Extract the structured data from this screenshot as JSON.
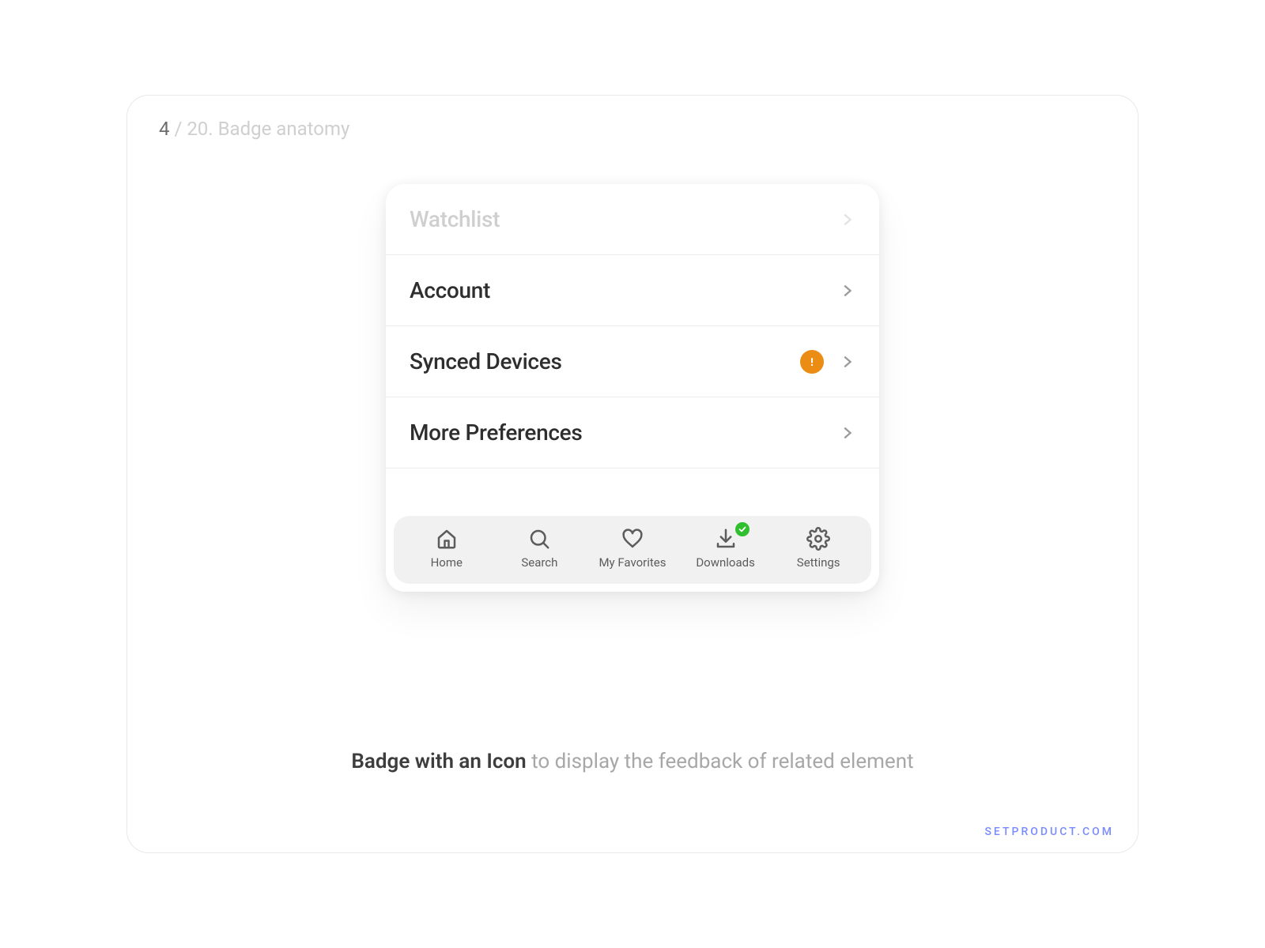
{
  "breadcrumb": {
    "current": "4",
    "separator": " / ",
    "total": "20. Badge anatomy"
  },
  "list": {
    "items": [
      {
        "label": "Watchlist",
        "badge": null,
        "disabled": true
      },
      {
        "label": "Account",
        "badge": null,
        "disabled": false
      },
      {
        "label": "Synced Devices",
        "badge": "alert",
        "disabled": false
      },
      {
        "label": "More Preferences",
        "badge": null,
        "disabled": false
      }
    ]
  },
  "tabs": {
    "items": [
      {
        "label": "Home",
        "icon": "home",
        "badge": null
      },
      {
        "label": "Search",
        "icon": "search",
        "badge": null
      },
      {
        "label": "My Favorites",
        "icon": "heart",
        "badge": null
      },
      {
        "label": "Downloads",
        "icon": "download",
        "badge": "success"
      },
      {
        "label": "Settings",
        "icon": "gear",
        "badge": null
      }
    ]
  },
  "caption": {
    "strong": "Badge with an Icon",
    "rest": " to display the feedback of related element"
  },
  "watermark": "SETPRODUCT.COM",
  "colors": {
    "alert_badge": "#eb8c14",
    "success_badge": "#2fbf2f"
  }
}
